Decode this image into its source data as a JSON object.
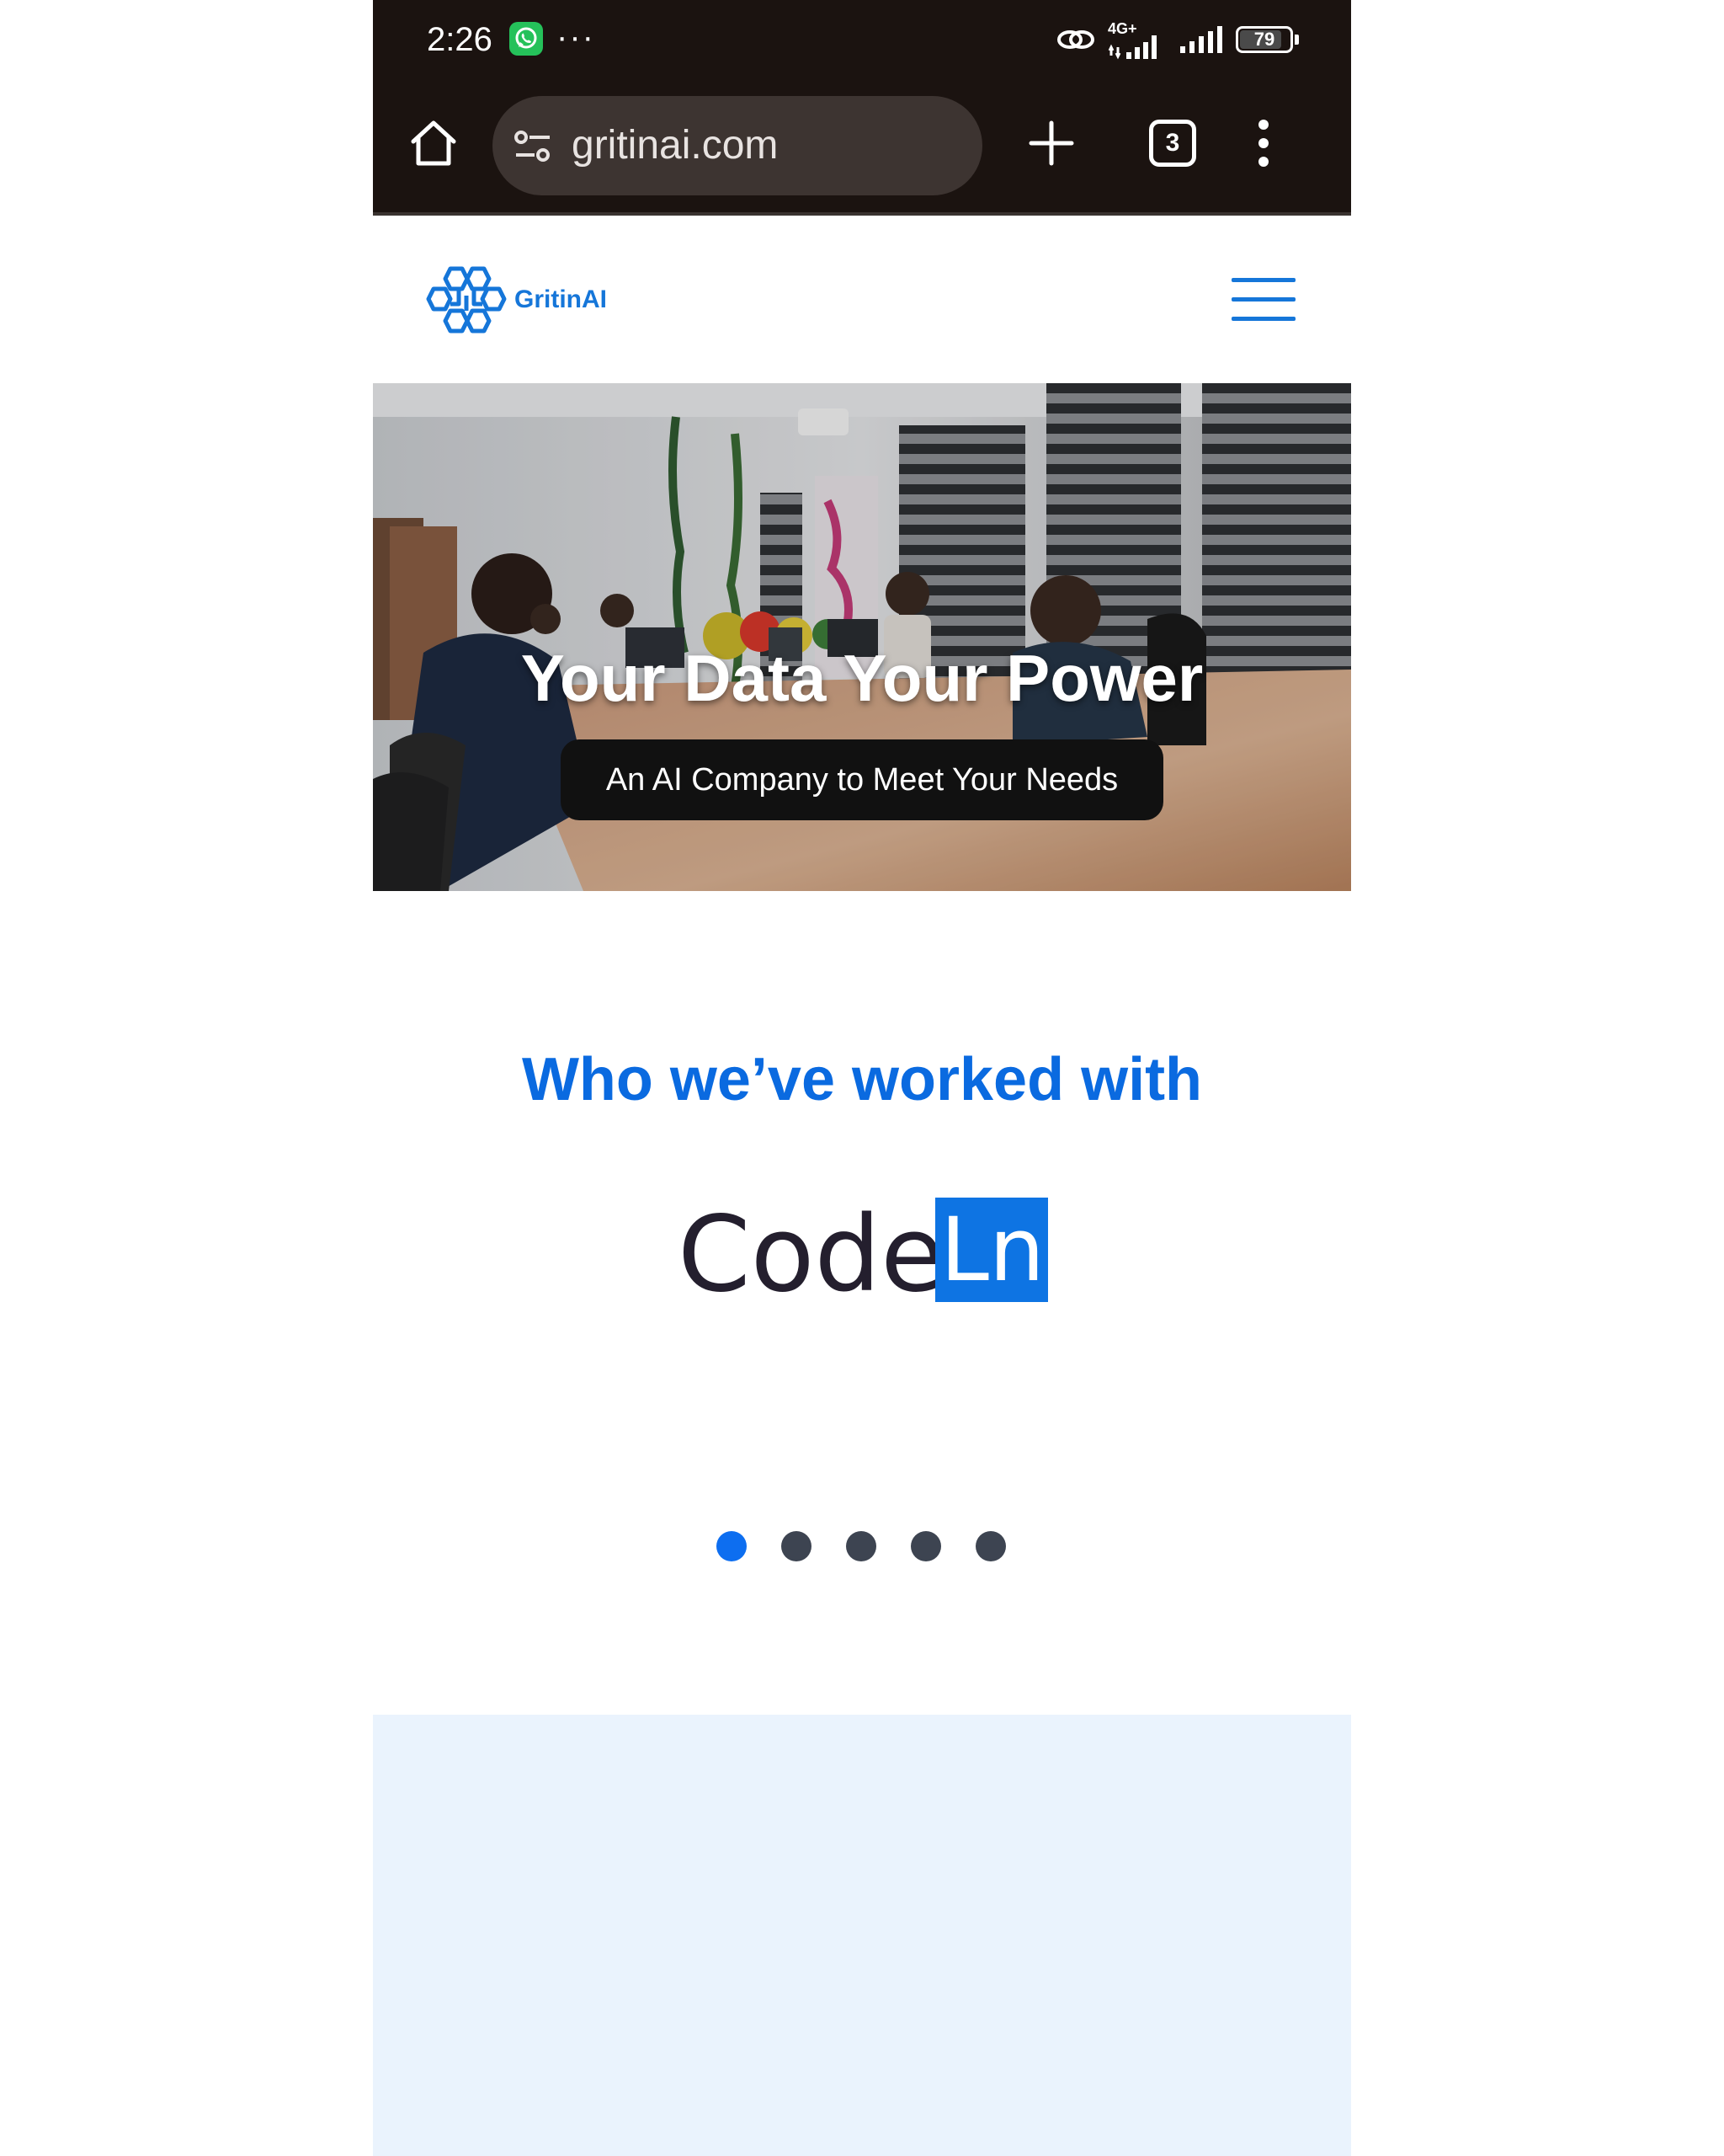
{
  "status_bar": {
    "time": "2:26",
    "more_indicator": "···",
    "network_label": "4G+",
    "battery_percent": "79",
    "icons": [
      "whatsapp-icon",
      "link-icon",
      "signal-icon",
      "signal-icon",
      "battery-icon"
    ]
  },
  "browser": {
    "url": "gritinai.com",
    "tab_count": "3",
    "icons": [
      "home-icon",
      "site-settings-icon",
      "plus-icon",
      "tabs-icon",
      "more-vert-icon"
    ]
  },
  "header": {
    "logo_text": "GritinAI",
    "menu_icon": "hamburger-icon",
    "accent_color": "#1576d9"
  },
  "hero": {
    "title": "Your Data Your Power",
    "subtitle": "An AI Company to Meet Your Needs"
  },
  "partners": {
    "title": "Who we’ve worked with",
    "logo_word": "Code",
    "logo_box": "Ln",
    "title_color": "#0a6ae0",
    "carousel": {
      "total": 5,
      "active_index": 0
    }
  }
}
